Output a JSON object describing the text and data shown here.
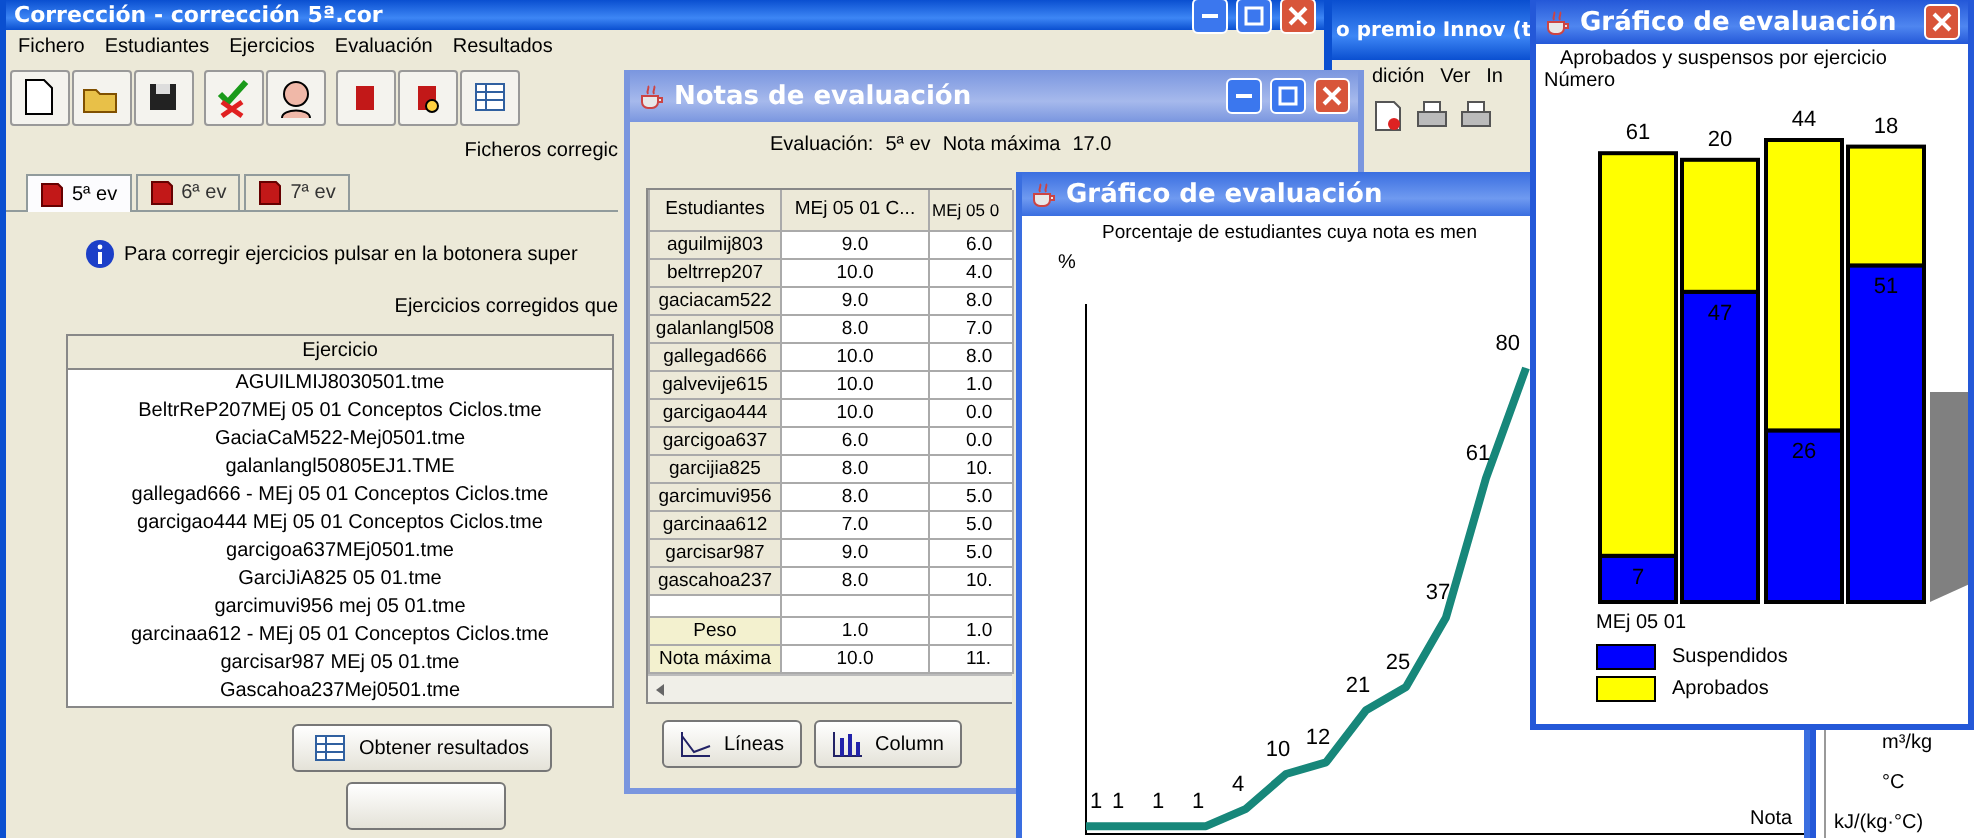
{
  "main_window": {
    "title": "Corrección - corrección 5ª.cor",
    "menu": [
      "Fichero",
      "Estudiantes",
      "Ejercicios",
      "Evaluación",
      "Resultados"
    ],
    "files_caption": "Ficheros corregic",
    "tabs": [
      {
        "label": "5ª ev",
        "selected": true
      },
      {
        "label": "6ª ev",
        "selected": false
      },
      {
        "label": "7ª ev",
        "selected": false
      }
    ],
    "info": "Para corregir ejercicios pulsar en la botonera super",
    "list_caption": "Ejercicios corregidos que",
    "list": {
      "column": "Ejercicio",
      "rows": [
        "AGUILMIJ8030501.tme",
        "BeltrReP207MEj 05 01 Conceptos Ciclos.tme",
        "GaciaCaM522-Mej0501.tme",
        "galanlangl50805EJ1.TME",
        "gallegad666 - MEj 05 01 Conceptos Ciclos.tme",
        "garcigao444 MEj 05 01 Conceptos Ciclos.tme",
        "garcigoa637MEj0501.tme",
        "GarciJiA825 05 01.tme",
        "garcimuvi956 mej 05 01.tme",
        "garcinaa612 - MEj 05 01 Conceptos Ciclos.tme",
        "garcisar987 MEj 05 01.tme",
        "Gascahoa237Mej0501.tme"
      ]
    },
    "buttons": [
      "Obtener resultados"
    ]
  },
  "background_window": {
    "title": "o premio Innov (t",
    "menu": [
      "dición",
      "Ver",
      "In"
    ]
  },
  "notes_window": {
    "title": "Notas de evaluación",
    "evaluation_label": "Evaluación:",
    "evaluation": "5ª ev",
    "max_label": "Nota máxima",
    "max_value": "17.0",
    "columns": [
      "Estudiantes",
      "MEj 05 01 C...",
      "MEj 05 0"
    ],
    "rows": [
      {
        "name": "aguilmij803",
        "values": [
          "9.0",
          "6.0"
        ]
      },
      {
        "name": "beltrrep207",
        "values": [
          "10.0",
          "4.0"
        ]
      },
      {
        "name": "gaciacam522",
        "values": [
          "9.0",
          "8.0"
        ]
      },
      {
        "name": "galanlangl508",
        "values": [
          "8.0",
          "7.0"
        ]
      },
      {
        "name": "gallegad666",
        "values": [
          "10.0",
          "8.0"
        ]
      },
      {
        "name": "galvevije615",
        "values": [
          "10.0",
          "1.0"
        ]
      },
      {
        "name": "garcigao444",
        "values": [
          "10.0",
          "0.0"
        ]
      },
      {
        "name": "garcigoa637",
        "values": [
          "6.0",
          "0.0"
        ]
      },
      {
        "name": "garcijia825",
        "values": [
          "8.0",
          "10."
        ]
      },
      {
        "name": "garcimuvi956",
        "values": [
          "8.0",
          "5.0"
        ]
      },
      {
        "name": "garcinaa612",
        "values": [
          "7.0",
          "5.0"
        ]
      },
      {
        "name": "garcisar987",
        "values": [
          "9.0",
          "5.0"
        ]
      },
      {
        "name": "gascahoa237",
        "values": [
          "8.0",
          "10."
        ]
      }
    ],
    "summary_rows": [
      {
        "name": "Peso",
        "values": [
          "1.0",
          "1.0"
        ]
      },
      {
        "name": "Nota máxima",
        "values": [
          "10.0",
          "11."
        ]
      }
    ],
    "buttons": [
      {
        "label": "Líneas",
        "kind": "lines"
      },
      {
        "label": "Column",
        "kind": "columns"
      }
    ]
  },
  "line_window": {
    "title": "Gráfico de evaluación",
    "axis_caption": "Nota",
    "chart_data": {
      "type": "line",
      "title": "Porcentaje de estudiantes cuya nota es men",
      "ylabel": "%",
      "series": [
        {
          "color": "#17877a",
          "values": [
            1,
            1,
            1,
            1,
            4,
            10,
            12,
            21,
            25,
            37,
            61,
            80
          ]
        }
      ],
      "data_labels": true
    }
  },
  "bar_window": {
    "title": "Gráfico de evaluación",
    "category_caption": "MEj 05 01",
    "chart_data": {
      "type": "bar",
      "stacked": true,
      "title": "Aprobados y suspensos por ejercicio",
      "ylabel": "Número",
      "categories": [
        null,
        null,
        null,
        null
      ],
      "legend": "bottom",
      "series": [
        {
          "name": "Suspendidos",
          "color": "#0000ff",
          "values": [
            7,
            47,
            26,
            51
          ]
        },
        {
          "name": "Aprobados",
          "color": "#ffff00",
          "values": [
            61,
            20,
            44,
            18
          ]
        }
      ],
      "data_labels": true
    }
  },
  "units": [
    "m³/kg",
    "°C",
    "kJ/(kg·°C)"
  ]
}
